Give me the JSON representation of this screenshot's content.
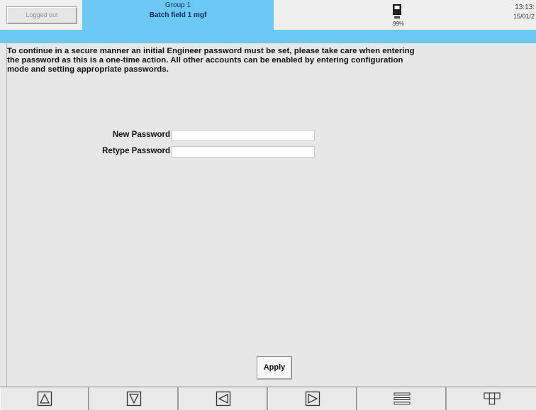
{
  "header": {
    "login_status": "Logged out",
    "group_name": "Group 1",
    "group_subtitle": "Batch field 1 mgf",
    "storage_percent": "99%",
    "time": "13:13:",
    "date": "15/01/2"
  },
  "message": "To continue in a secure manner an initial Engineer password must be set, please take care when entering\nthe password as this is a one-time action. All other accounts can be enabled by entering configuration\nmode and setting appropriate passwords.",
  "form": {
    "new_password_label": "New Password",
    "new_password_value": "",
    "retype_password_label": "Retype Password",
    "retype_password_value": "",
    "apply_label": "Apply"
  },
  "nav": {
    "buttons": [
      {
        "icon": "up-arrow-icon"
      },
      {
        "icon": "down-arrow-icon"
      },
      {
        "icon": "left-arrow-icon"
      },
      {
        "icon": "right-arrow-icon"
      },
      {
        "icon": "menu-icon"
      },
      {
        "icon": "grid-icon"
      }
    ]
  },
  "colors": {
    "accent": "#6cc8f4",
    "background": "#e7e7e7",
    "header_text": "#0f2c52"
  }
}
